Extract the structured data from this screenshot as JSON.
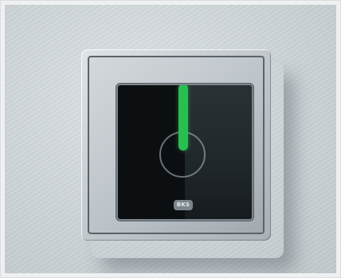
{
  "scene": {
    "colors": {
      "wall": "#d3d9dd",
      "plate": "#c3c9cd",
      "screen": "#0c0f11",
      "indicator": "#27c04f"
    },
    "indicator_state": "on",
    "logo_text": "BKS"
  }
}
